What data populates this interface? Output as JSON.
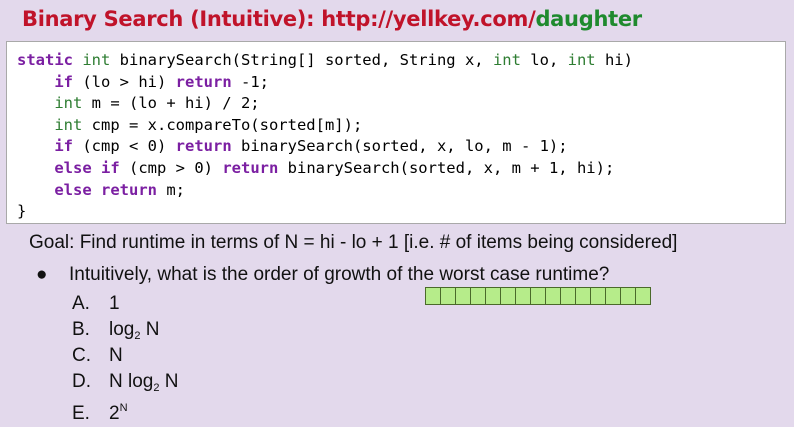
{
  "slide": {
    "title_prefix": "Binary Search (Intuitive): http://yellkey.com/",
    "title_link_word": "daughter",
    "code_lines": [
      {
        "indent": "",
        "parts": [
          {
            "t": "static",
            "c": "kw"
          },
          {
            "t": " ",
            "c": ""
          },
          {
            "t": "int",
            "c": "ty"
          },
          {
            "t": " binarySearch(String[] sorted, String x, ",
            "c": ""
          },
          {
            "t": "int",
            "c": "ty"
          },
          {
            "t": " lo, ",
            "c": ""
          },
          {
            "t": "int",
            "c": "ty"
          },
          {
            "t": " hi)",
            "c": ""
          }
        ]
      },
      {
        "indent": "    ",
        "parts": [
          {
            "t": "if",
            "c": "kw"
          },
          {
            "t": " (lo > hi) ",
            "c": ""
          },
          {
            "t": "return",
            "c": "kw"
          },
          {
            "t": " -1;",
            "c": ""
          }
        ]
      },
      {
        "indent": "    ",
        "parts": [
          {
            "t": "int",
            "c": "ty"
          },
          {
            "t": " m = (lo + hi) / 2;",
            "c": ""
          }
        ]
      },
      {
        "indent": "    ",
        "parts": [
          {
            "t": "int",
            "c": "ty"
          },
          {
            "t": " cmp = x.compareTo(sorted[m]);",
            "c": ""
          }
        ]
      },
      {
        "indent": "    ",
        "parts": [
          {
            "t": "if",
            "c": "kw"
          },
          {
            "t": " (cmp < 0) ",
            "c": ""
          },
          {
            "t": "return",
            "c": "kw"
          },
          {
            "t": " binarySearch(sorted, x, lo, m - 1);",
            "c": ""
          }
        ]
      },
      {
        "indent": "    ",
        "parts": [
          {
            "t": "else",
            "c": "kw"
          },
          {
            "t": " ",
            "c": ""
          },
          {
            "t": "if",
            "c": "kw"
          },
          {
            "t": " (cmp > 0) ",
            "c": ""
          },
          {
            "t": "return",
            "c": "kw"
          },
          {
            "t": " binarySearch(sorted, x, m + 1, hi);",
            "c": ""
          }
        ]
      },
      {
        "indent": "    ",
        "parts": [
          {
            "t": "else",
            "c": "kw"
          },
          {
            "t": " ",
            "c": ""
          },
          {
            "t": "return",
            "c": "kw"
          },
          {
            "t": " m;",
            "c": ""
          }
        ]
      },
      {
        "indent": "",
        "parts": [
          {
            "t": "}",
            "c": ""
          }
        ]
      }
    ],
    "goal": "Goal: Find runtime in terms of N = hi - lo + 1  [i.e. # of items being considered]",
    "bullet_symbol": "●",
    "question": "Intuitively, what is the order of growth of the worst case runtime?",
    "options": [
      {
        "letter": "A.",
        "text": "1",
        "sub": "",
        "after": "",
        "sup": ""
      },
      {
        "letter": "B.",
        "text": "log",
        "sub": "2",
        "after": " N",
        "sup": ""
      },
      {
        "letter": "C.",
        "text": "N",
        "sub": "",
        "after": "",
        "sup": ""
      },
      {
        "letter": "D.",
        "text": "N log",
        "sub": "2",
        "after": " N",
        "sup": ""
      },
      {
        "letter": "E.",
        "text": "2",
        "sub": "",
        "after": "",
        "sup": "N"
      }
    ],
    "array_cell_count": 15,
    "colors": {
      "background": "#e3d9ec",
      "title_red": "#c0132a",
      "title_green": "#1f8a2e",
      "keyword_purple": "#7b1fa2",
      "type_green": "#2e7d32",
      "array_cell_green": "#b6ec8a"
    }
  }
}
